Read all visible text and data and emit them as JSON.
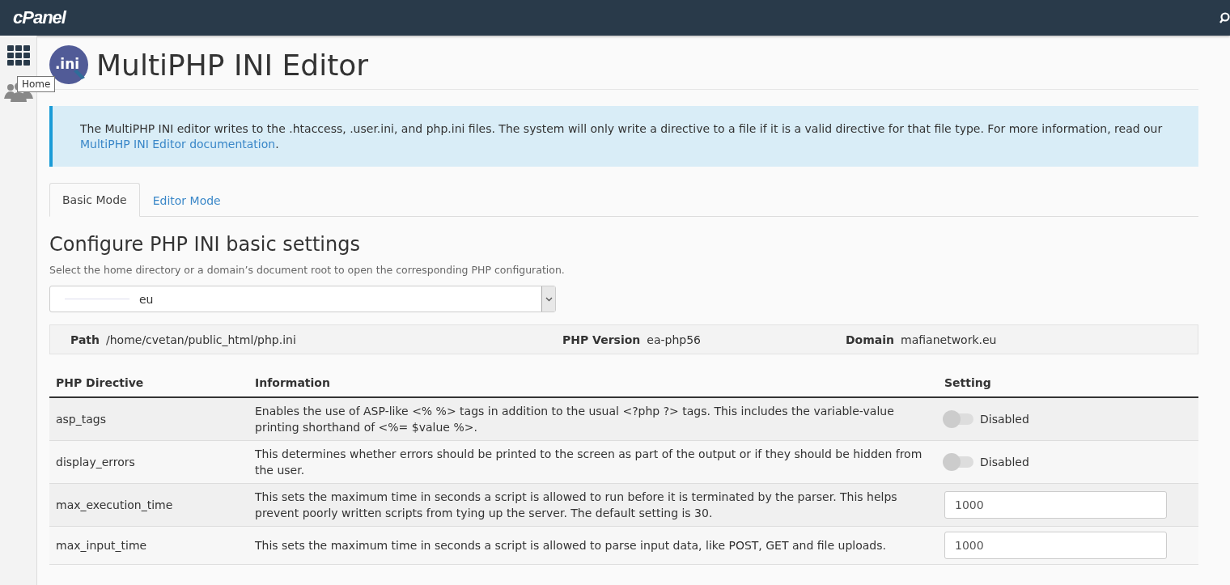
{
  "topbar": {
    "logo": "cPanel"
  },
  "tooltip": "Home",
  "page": {
    "title": "MultiPHP INI Editor",
    "icon_text": ".ini"
  },
  "notice": {
    "text": "The MultiPHP INI editor writes to the .htaccess, .user.ini, and php.ini files. The system will only write a directive to a file if it is a valid directive for that file type. For more information, read our ",
    "link": "MultiPHP INI Editor documentation",
    "end": "."
  },
  "tabs": [
    {
      "label": "Basic Mode",
      "selected": true
    },
    {
      "label": "Editor Mode",
      "selected": false
    }
  ],
  "section": {
    "title": "Configure PHP INI basic settings",
    "hint": "Select the home directory or a domain’s document root to open the corresponding PHP configuration."
  },
  "select": {
    "value": "eu"
  },
  "info": [
    {
      "label": "Path",
      "value": "/home/cvetan/public_html/php.ini"
    },
    {
      "label": "PHP Version",
      "value": "ea-php56"
    },
    {
      "label": "Domain",
      "value": "mafianetwork.eu"
    }
  ],
  "table": {
    "columns": [
      "PHP Directive",
      "Information",
      "Setting"
    ],
    "rows": [
      {
        "kind": "toggle",
        "directive": "asp_tags",
        "information": "Enables the use of ASP-like <% %> tags in addition to the usual <?php ?> tags. This includes the variable-value printing shorthand of <%= $value %>.",
        "on": false,
        "label": "Disabled"
      },
      {
        "kind": "toggle",
        "directive": "display_errors",
        "information": "This determines whether errors should be printed to the screen as part of the output or if they should be hidden from the user.",
        "on": false,
        "label": "Disabled"
      },
      {
        "kind": "number",
        "directive": "max_execution_time",
        "information": "This sets the maximum time in seconds a script is allowed to run before it is terminated by the parser. This helps prevent poorly written scripts from tying up the server. The default setting is 30.",
        "value": "1000"
      },
      {
        "kind": "number",
        "directive": "max_input_time",
        "information": "This sets the maximum time in seconds a script is allowed to parse input data, like POST, GET and file uploads.",
        "value": "1000"
      }
    ]
  }
}
